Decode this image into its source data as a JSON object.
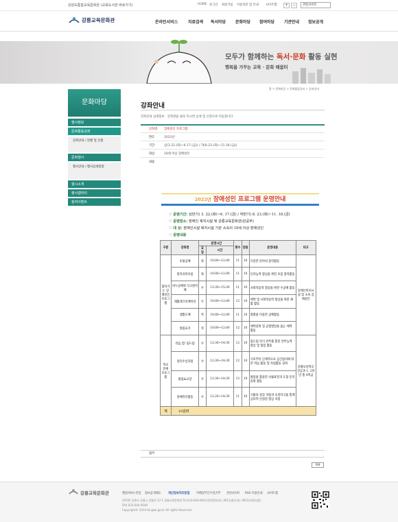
{
  "topbar": {
    "org_text": "강원도통합교육문화관 (교육도서관 바로가기)",
    "util_links": [
      "HOME",
      "로그인",
      "회원가입",
      "이용약관 및 안내",
      "사이트맵"
    ],
    "zoom_in": "+",
    "zoom_out": "−",
    "family_site": "관련사이트"
  },
  "header": {
    "logo": "강릉교육문화관",
    "nav": [
      "온라인서비스",
      "자료검색",
      "독서마당",
      "문화마당",
      "참여마당",
      "기관안내",
      "정보공개"
    ]
  },
  "banner": {
    "line1_a": "모두가 함께하는 ",
    "line1_b": "독서·문화",
    "line1_c": " 활동 실현",
    "line2": "행복을 가꾸는 교육 · 문화 배움터"
  },
  "sidebar": {
    "title": "문화마당",
    "items": [
      {
        "label": "행사정보"
      },
      {
        "label": "문화활동강좌"
      },
      {
        "label": "강좌안내 / 현황 및 신청"
      },
      {
        "label": "문화행사"
      },
      {
        "label": "행사안내 / 행사상세일정"
      },
      {
        "label": "갤시소개"
      },
      {
        "label": "행사갤러리"
      },
      {
        "label": "참여이벤트"
      }
    ]
  },
  "content": {
    "title": "강좌안내",
    "breadcrumb": "홈 > 문화마당 > 문화활동강좌 > 강좌안내",
    "intro": "강좌안내 상세정보 · 강좌명을 클릭 하시면 상세 및 신청으로 이동합니다.",
    "info": [
      {
        "k": "강좌명",
        "v": "장애성인 프로그램"
      },
      {
        "k": "연도",
        "v": "2022년"
      },
      {
        "k": "기간",
        "v": "상(3.22.(화)~6.17.(금)) / 하(8.23.(화)~11.18.(금))"
      },
      {
        "k": "대상",
        "v": "18세 이상 장애성인"
      },
      {
        "k": "내용",
        "v": ""
      }
    ],
    "attach_label": "첨부",
    "list_button": "목록"
  },
  "poster": {
    "year": "2022년",
    "title": "장애성인 프로그램 운영안내",
    "period_label": "운영기간:",
    "period": "상반기) 3. 22.(화)~6. 17.(금) / 하반기) 8. 23.(화)~11. 18.(금)",
    "place_label": "운영장소:",
    "place": "장애인 복지시설 및 강릉교육문화관(관공부)",
    "target_label": "대    상:",
    "target": "장애인시설 복지시설 기관 소속의 18세 이상 장애성인",
    "content_label": "운영내용",
    "headers": {
      "group": "구분",
      "name": "강좌명",
      "time": "운영시간",
      "day": "요일",
      "hours": "시간",
      "count": "횟수",
      "people": "정원",
      "desc": "운영내용",
      "note": "비고"
    },
    "group1": "찾아가는 장애성인 프로그램",
    "group2": "학교 연계 프로그램",
    "note1": "장애인복지시설 및 소속 장애성인",
    "note2": "강릉오성학교 전공과 1, 2학년 총 4학급",
    "rows": [
      {
        "name": "토탈공예",
        "day": "화",
        "time": "10:00~12:00",
        "count": "11",
        "people": "10",
        "desc": "다양한 분야의 창작활동"
      },
      {
        "name": "창작과학조립",
        "day": "화",
        "time": "10:00~12:00",
        "count": "11",
        "people": "10",
        "desc": "인지능력 향상을 위한 조립 창작활동"
      },
      {
        "name": "비누공예와 식고원작예",
        "day": "수",
        "time": "13:30~15:30",
        "count": "11",
        "people": "10",
        "desc": "사회적응력 향상을 위한 수공예 활동"
      },
      {
        "name": "재활레크리에이션",
        "day": "수",
        "time": "10:00~12:00",
        "count": "12",
        "people": "10",
        "desc": "체력 및 사회적응력 향상을 위한 재활 활동"
      },
      {
        "name": "생활도예",
        "day": "목",
        "time": "10:00~12:00",
        "count": "11",
        "people": "10",
        "desc": "찰흙을 이용한 공예활동"
      },
      {
        "name": "힐링요가",
        "day": "목",
        "time": "10:00~12:00",
        "count": "12",
        "people": "10",
        "desc": "체력강화 및 균형발달을 돕는 체력 활동"
      },
      {
        "name": "리듬 업! 핑드럼",
        "day": "수",
        "time": "12:30~14:30",
        "count": "12",
        "people": "10",
        "desc": "핑드럼 악기 연주를 통한 연주능력 향상 및 협업 활동"
      },
      {
        "name": "정리수납과정",
        "day": "수",
        "time": "12:30~14:30",
        "count": "12",
        "people": "10",
        "desc": "기초부터 단계적으로 공간정리에 대한 학습 활동 및 자립활동 강화"
      },
      {
        "name": "볼링&교양",
        "day": "수",
        "time": "12:30~14:30",
        "count": "12",
        "people": "10",
        "desc": "볼링을 활용한 사물표현과 도형 인지 강화 활동"
      },
      {
        "name": "원예치유활동",
        "day": "수",
        "time": "12:20~14:30",
        "count": "11",
        "people": "10",
        "desc": "식물의 성장 과정과 오감자극을 통해 심리적 안정감 향상 과정"
      }
    ],
    "total_label": "계",
    "total_value": "10강좌"
  },
  "footer": {
    "logo": "강릉교육문화관",
    "links": [
      "행정서비스헌장",
      "정보공개제도",
      "개인정보처리방침",
      "이메일무단수집거부",
      "관련사이트",
      "RSS 이용안내",
      "사이트맵"
    ],
    "addr": "25502 강원도 강릉시 강릉로 37-1 강릉교육문화관 Tel.033-640-9041(문헌정보과), 9911(총무과), 9952(자원지원)",
    "fax": "FAX 033-640-9049",
    "copyright": "Copyright© 2014 Ile.gwe.go.kr All rights Reserved."
  }
}
